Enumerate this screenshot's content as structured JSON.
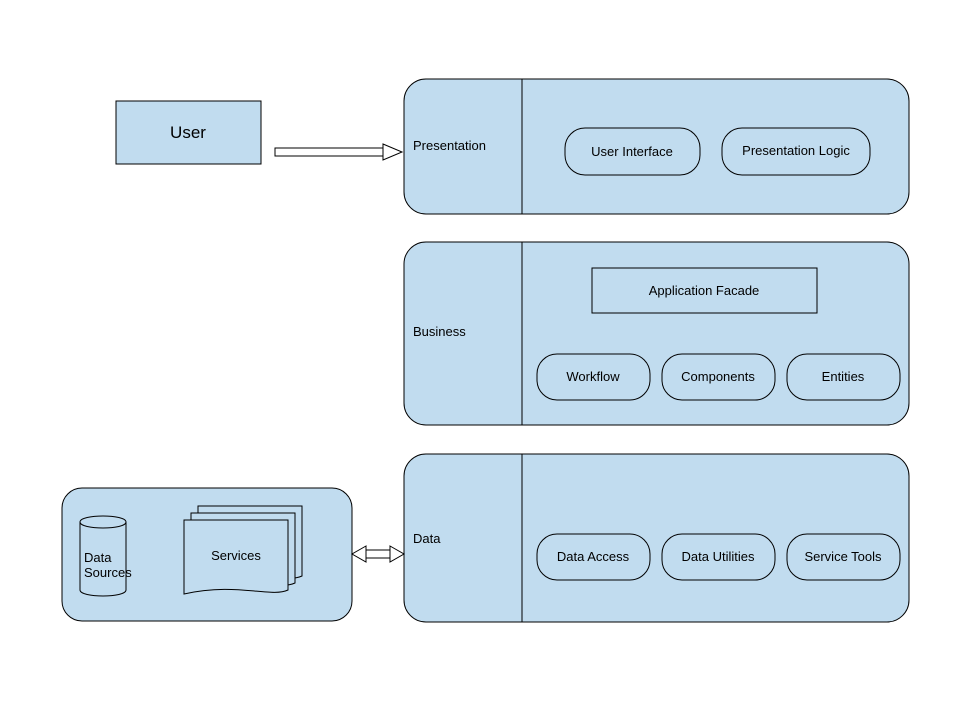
{
  "user_box": {
    "label": "User"
  },
  "layers": {
    "presentation": {
      "title": "Presentation",
      "items": [
        "User Interface",
        "Presentation Logic"
      ]
    },
    "business": {
      "title": "Business",
      "facade": "Application Facade",
      "items": [
        "Workflow",
        "Components",
        "Entities"
      ]
    },
    "data": {
      "title": "Data",
      "items": [
        "Data Access",
        "Data Utilities",
        "Service Tools"
      ]
    }
  },
  "external": {
    "data_sources": "Data\nSources",
    "services": "Services"
  }
}
